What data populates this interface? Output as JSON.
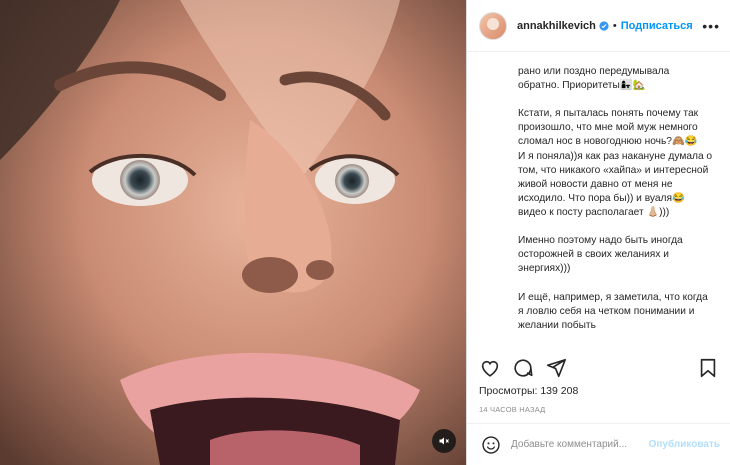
{
  "post": {
    "username": "annakhilkevich",
    "verified_icon": "verified-badge-icon",
    "separator": "•",
    "follow_label": "Подписаться",
    "more_icon": "more-options-icon",
    "more_label": "•••",
    "caption": "рано или поздно передумывала обратно. Приоритеты👩‍👧🏡\n\nКстати, я пыталась понять почему так произошло, что мне мой муж немного сломал нос в новогоднюю ночь?🙈😂\nИ я поняла))я как раз накануне думала о том, что никакого «хайпа» и интересной живой новости давно от меня не исходило. Что пора бы)) и вуаля😂 видео к посту располагает 👃🏼)))\n\nИменно поэтому надо быть иногда осторожней в своих желаниях и энергиях)))\n\nИ ещё, например, я заметила, что когда я ловлю себя на четком понимании и желании побыть",
    "views_label": "Просмотры:",
    "views_count": "139 208",
    "time_ago": "14 ЧАСОВ НАЗАД",
    "comment_placeholder": "Добавьте комментарий...",
    "publish_label": "Опубликовать",
    "accent_color": "#0095f6"
  },
  "icons": {
    "like": "heart-icon",
    "comment": "comment-icon",
    "share": "share-icon",
    "save": "bookmark-icon",
    "emoji": "emoji-icon",
    "mute": "muted-speaker-icon"
  }
}
